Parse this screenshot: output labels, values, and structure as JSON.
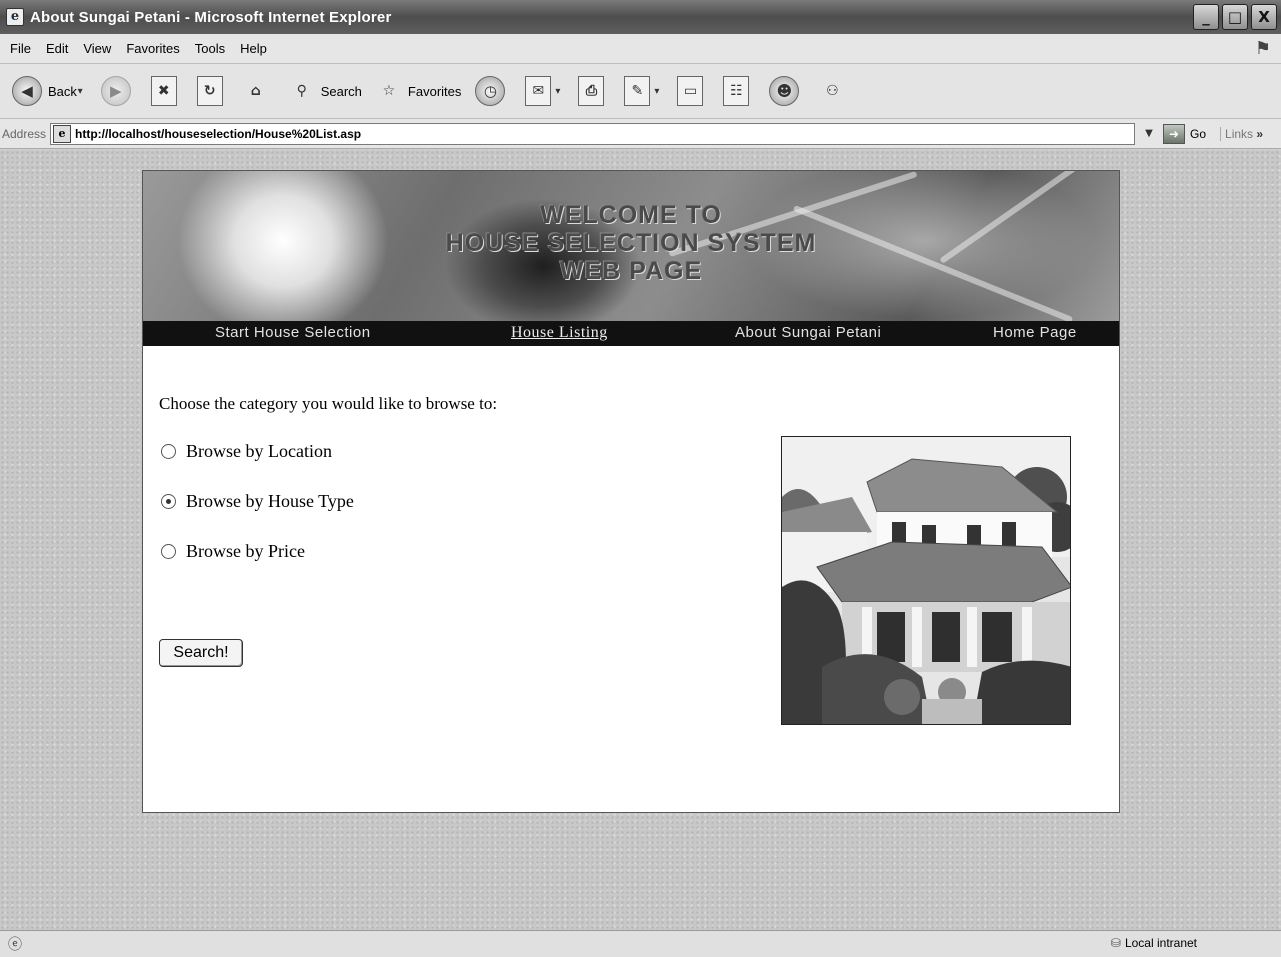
{
  "window": {
    "title": "About Sungai Petani - Microsoft Internet Explorer",
    "minimize": "_",
    "maximize": "□",
    "close": "X"
  },
  "menu": [
    "File",
    "Edit",
    "View",
    "Favorites",
    "Tools",
    "Help"
  ],
  "toolbar": {
    "back_label": "Back",
    "search_label": "Search",
    "favorites_label": "Favorites"
  },
  "address": {
    "label": "Address",
    "url": "http://localhost/houseselection/House%20List.asp",
    "go_label": "Go",
    "links_label": "Links",
    "links_chevron": "»"
  },
  "page": {
    "banner_lines": [
      "WELCOME TO",
      "HOUSE SELECTION SYSTEM",
      "WEB PAGE"
    ],
    "nav": {
      "start": "Start House Selection",
      "listing": "House Listing",
      "about": "About Sungai Petani",
      "home": "Home Page"
    },
    "prompt": "Choose the category you would like to browse to:",
    "options": [
      {
        "label": "Browse by Location",
        "checked": false
      },
      {
        "label": "Browse by House Type",
        "checked": true
      },
      {
        "label": "Browse by Price",
        "checked": false
      }
    ],
    "search_button": "Search!"
  },
  "status": {
    "zone": "Local intranet"
  },
  "icons": {
    "app": "ie-page-icon",
    "back": "back-arrow-icon",
    "forward": "forward-arrow-icon",
    "stop": "stop-icon",
    "refresh": "refresh-icon",
    "home": "home-icon",
    "search": "search-icon",
    "favorites": "star-icon",
    "history": "history-icon",
    "mail": "mail-icon",
    "print": "print-icon",
    "edit": "edit-icon",
    "discuss": "discuss-icon",
    "research": "research-icon",
    "messenger": "messenger-icon"
  }
}
